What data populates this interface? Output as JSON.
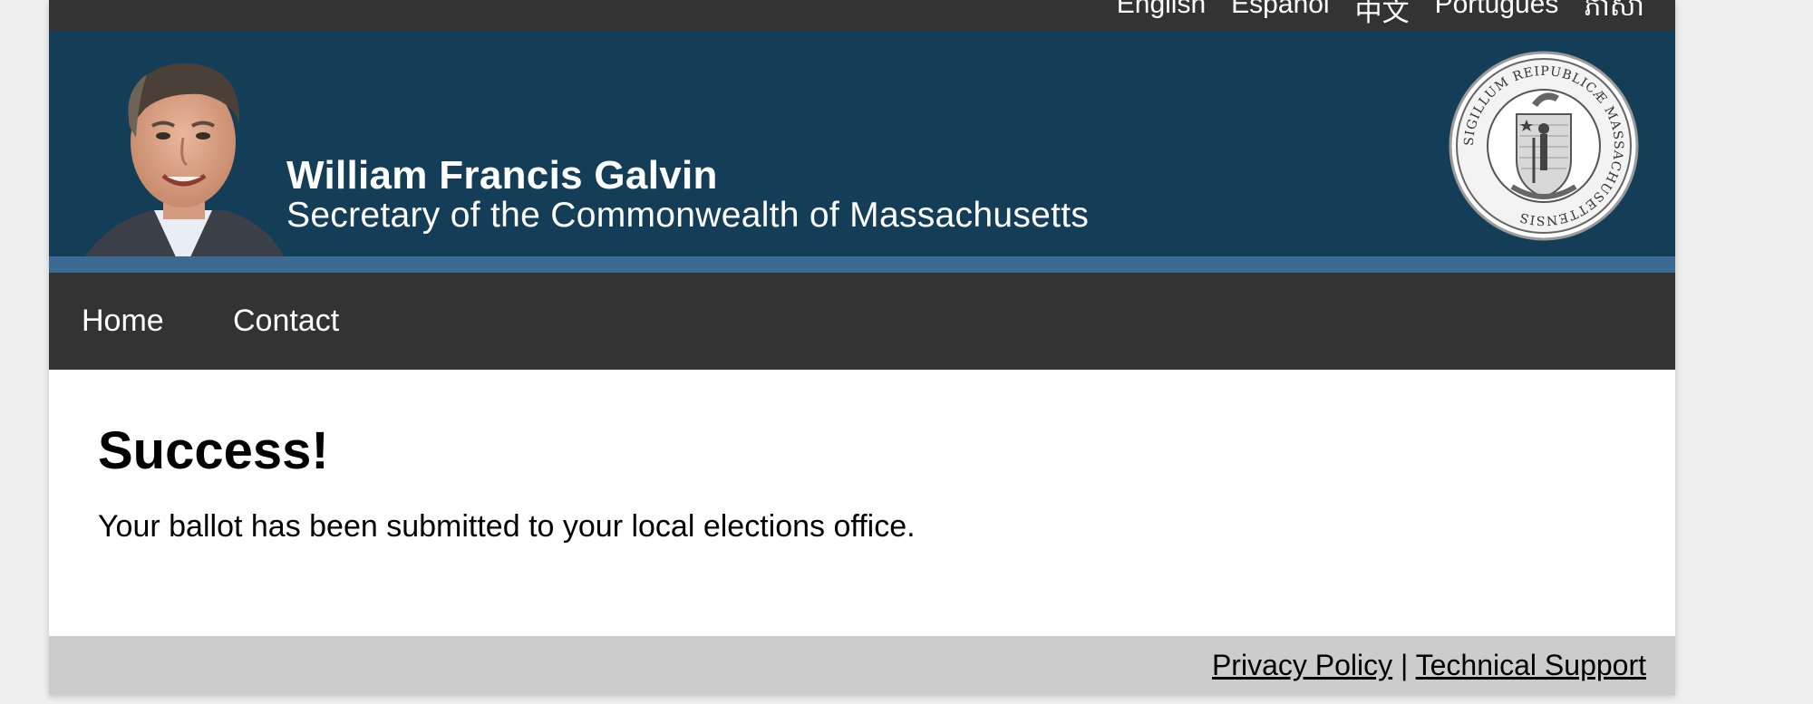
{
  "header": {
    "name": "William Francis Galvin",
    "title": "Secretary of the Commonwealth of Massachusetts"
  },
  "nav": {
    "items": [
      {
        "label": "Home"
      },
      {
        "label": "Contact"
      }
    ]
  },
  "main": {
    "heading": "Success!",
    "message": "Your ballot has been submitted to your local elections office."
  },
  "footer": {
    "links": [
      {
        "label": "Privacy Policy"
      },
      {
        "label": "Technical Support"
      }
    ],
    "separator": "|"
  },
  "seal": {
    "text": "SIGILLUM REIPUBLICÆ MASSACHUSETTENSIS"
  },
  "colors": {
    "banner": "#143d57",
    "banner_stripe": "#3b6b93",
    "nav_bg": "#333333",
    "footer_bg": "#cccccc",
    "page_bg": "#eeeeee"
  }
}
